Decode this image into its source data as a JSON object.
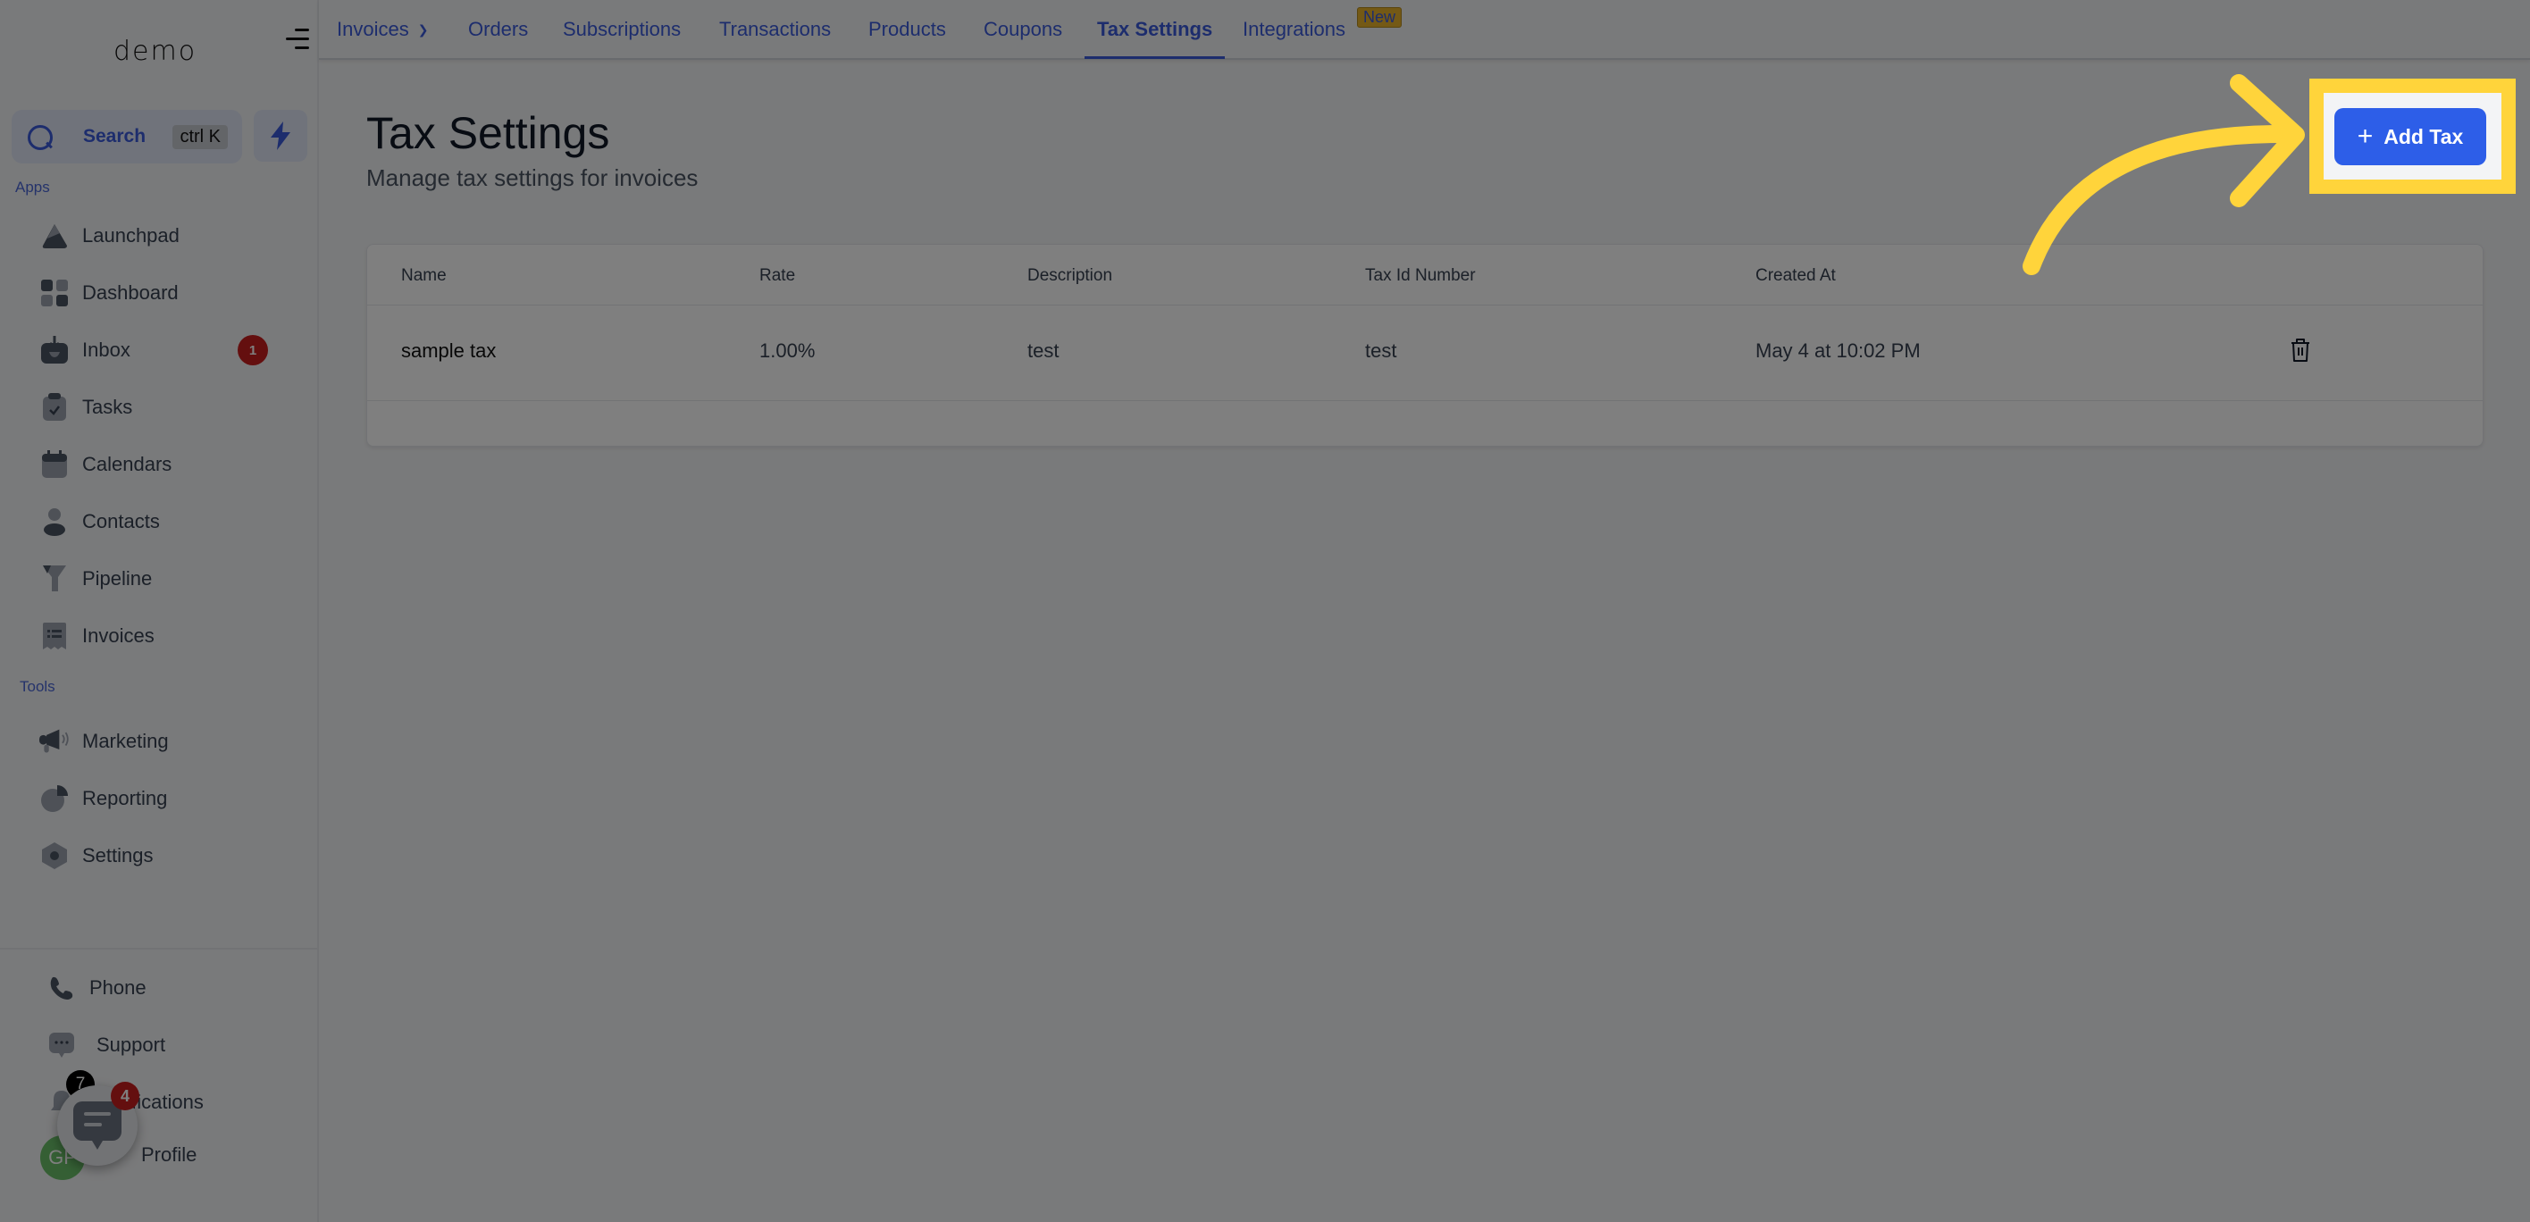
{
  "sidebar": {
    "logo": "demo",
    "search": {
      "label": "Search",
      "shortcut": "ctrl K"
    },
    "apps_label": "Apps",
    "apps": [
      {
        "label": "Launchpad",
        "icon": "launchpad-icon"
      },
      {
        "label": "Dashboard",
        "icon": "dashboard-icon"
      },
      {
        "label": "Inbox",
        "icon": "inbox-icon",
        "badge": "1"
      },
      {
        "label": "Tasks",
        "icon": "tasks-icon"
      },
      {
        "label": "Calendars",
        "icon": "calendar-icon"
      },
      {
        "label": "Contacts",
        "icon": "contacts-icon"
      },
      {
        "label": "Pipeline",
        "icon": "pipeline-icon"
      },
      {
        "label": "Invoices",
        "icon": "invoices-icon"
      }
    ],
    "tools_label": "Tools",
    "tools": [
      {
        "label": "Marketing",
        "icon": "megaphone-icon"
      },
      {
        "label": "Reporting",
        "icon": "pie-chart-icon"
      },
      {
        "label": "Settings",
        "icon": "settings-icon"
      }
    ],
    "bottom": [
      {
        "label": "Phone",
        "icon": "phone-icon"
      },
      {
        "label": "Support",
        "icon": "support-icon"
      },
      {
        "label": "Notifications",
        "icon": "bell-icon",
        "badge": "7"
      },
      {
        "label": "Profile",
        "avatar": "GP"
      }
    ],
    "chat_widget_badge": "4"
  },
  "topnav": {
    "tabs": [
      {
        "label": "Invoices",
        "dropdown": true
      },
      {
        "label": "Orders"
      },
      {
        "label": "Subscriptions"
      },
      {
        "label": "Transactions"
      },
      {
        "label": "Products"
      },
      {
        "label": "Coupons"
      },
      {
        "label": "Tax Settings",
        "active": true
      },
      {
        "label": "Integrations",
        "badge": "New"
      }
    ]
  },
  "main": {
    "title": "Tax Settings",
    "subtitle": "Manage tax settings for invoices",
    "add_button": "Add Tax",
    "table": {
      "columns": [
        "Name",
        "Rate",
        "Description",
        "Tax Id Number",
        "Created At"
      ],
      "rows": [
        {
          "name": "sample tax",
          "rate": "1.00%",
          "description": "test",
          "tax_id": "test",
          "created_at": "May 4 at 10:02 PM"
        }
      ]
    }
  },
  "colors": {
    "accent": "#3b5bdb",
    "button": "#2d5ee8",
    "highlight": "#ffd43b",
    "badge_red": "#c81e1e",
    "new_badge": "#e8b22a"
  }
}
